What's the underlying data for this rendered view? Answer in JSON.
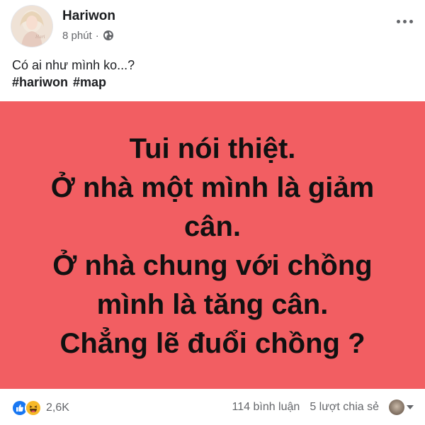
{
  "post": {
    "author": "Hariwon",
    "time": "8 phút",
    "separator": "·",
    "privacy_icon": "globe-icon",
    "menu_icon": "more-horizontal-icon",
    "caption": "Có ai như mình ko...?",
    "hashtags": [
      "#hariwon",
      "#map"
    ]
  },
  "image": {
    "background_color": "#f25e62",
    "lines": [
      "Tui nói thiệt.",
      "Ở nhà một mình là giảm",
      "cân.",
      "Ở nhà chung với chồng",
      "mình là tăng cân.",
      "Chẳng lẽ đuổi chồng ?"
    ]
  },
  "footer": {
    "reaction_icons": [
      "like-icon",
      "haha-icon"
    ],
    "reaction_count": "2,6K",
    "comments": "114 bình luận",
    "shares": "5 lượt chia sẻ",
    "audience_icon": "audience-avatar-icon",
    "dropdown_icon": "caret-down-icon"
  },
  "colors": {
    "like_blue": "#1877f2",
    "haha_yellow": "#f7b928",
    "meta_gray": "#65676b"
  }
}
